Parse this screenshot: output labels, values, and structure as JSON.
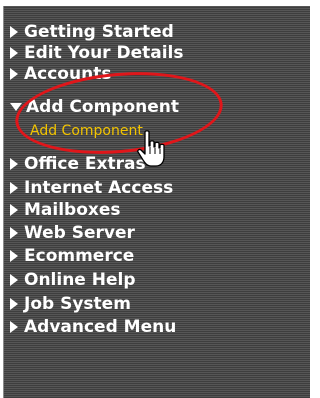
{
  "menu": {
    "items": [
      {
        "label": "Getting Started",
        "expanded": false
      },
      {
        "label": "Edit Your Details",
        "expanded": false
      },
      {
        "label": "Accounts",
        "expanded": false
      },
      {
        "label": "Add Component",
        "expanded": true,
        "subitems": [
          {
            "label": "Add Component"
          }
        ]
      },
      {
        "label": "Office Extras",
        "expanded": false
      },
      {
        "label": "Internet Access",
        "expanded": false
      },
      {
        "label": "Mailboxes",
        "expanded": false
      },
      {
        "label": "Web Server",
        "expanded": false
      },
      {
        "label": "Ecommerce",
        "expanded": false
      },
      {
        "label": "Online Help",
        "expanded": false
      },
      {
        "label": "Job System",
        "expanded": false
      },
      {
        "label": "Advanced Menu",
        "expanded": false
      }
    ]
  },
  "colors": {
    "menu_text": "#ffffff",
    "submenu_text": "#f2c400",
    "highlight_ellipse": "#e0161a",
    "menu_background": "#4a4a4a"
  },
  "icons": {
    "collapsed": "triangle-right-icon",
    "expanded": "triangle-down-icon",
    "cursor": "hand-pointer-icon"
  }
}
